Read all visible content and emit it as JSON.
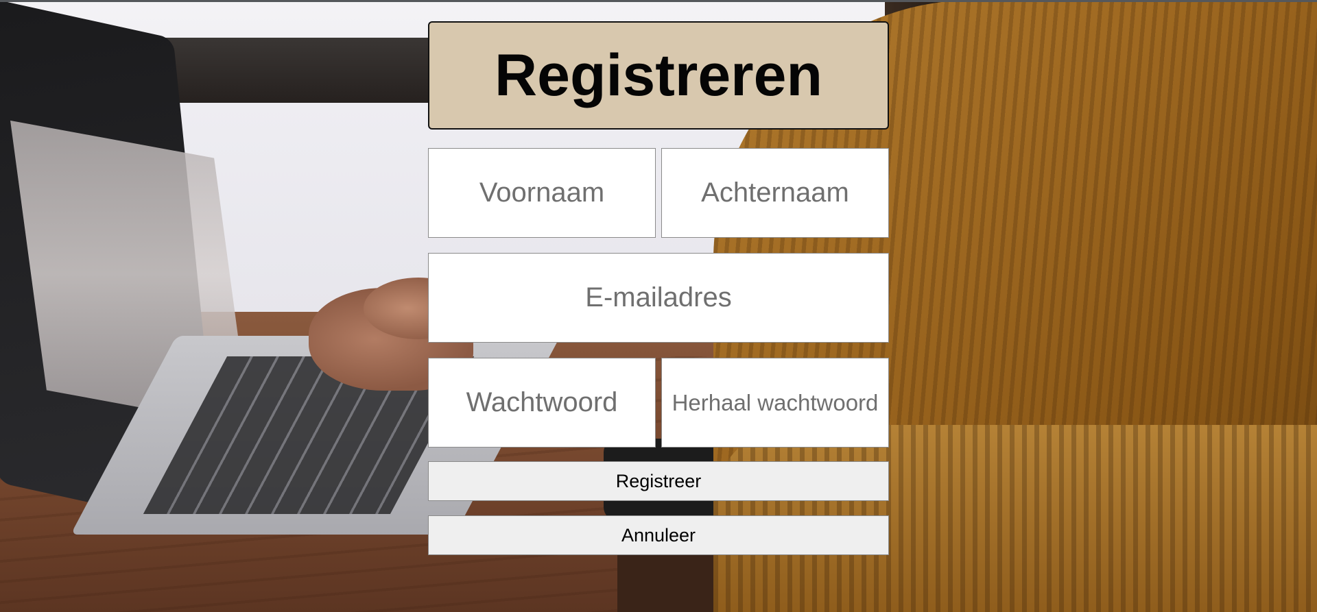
{
  "form": {
    "title": "Registreren",
    "fields": {
      "first_name": {
        "placeholder": "Voornaam",
        "value": ""
      },
      "last_name": {
        "placeholder": "Achternaam",
        "value": ""
      },
      "email": {
        "placeholder": "E-mailadres",
        "value": ""
      },
      "password": {
        "placeholder": "Wachtwoord",
        "value": ""
      },
      "repeat_password": {
        "placeholder": "Herhaal wachtwoord",
        "value": ""
      }
    },
    "buttons": {
      "register": "Registreer",
      "cancel": "Annuleer"
    }
  },
  "colors": {
    "title_background": "#d8c8ae",
    "button_background": "#efefef",
    "field_background": "#ffffff"
  }
}
